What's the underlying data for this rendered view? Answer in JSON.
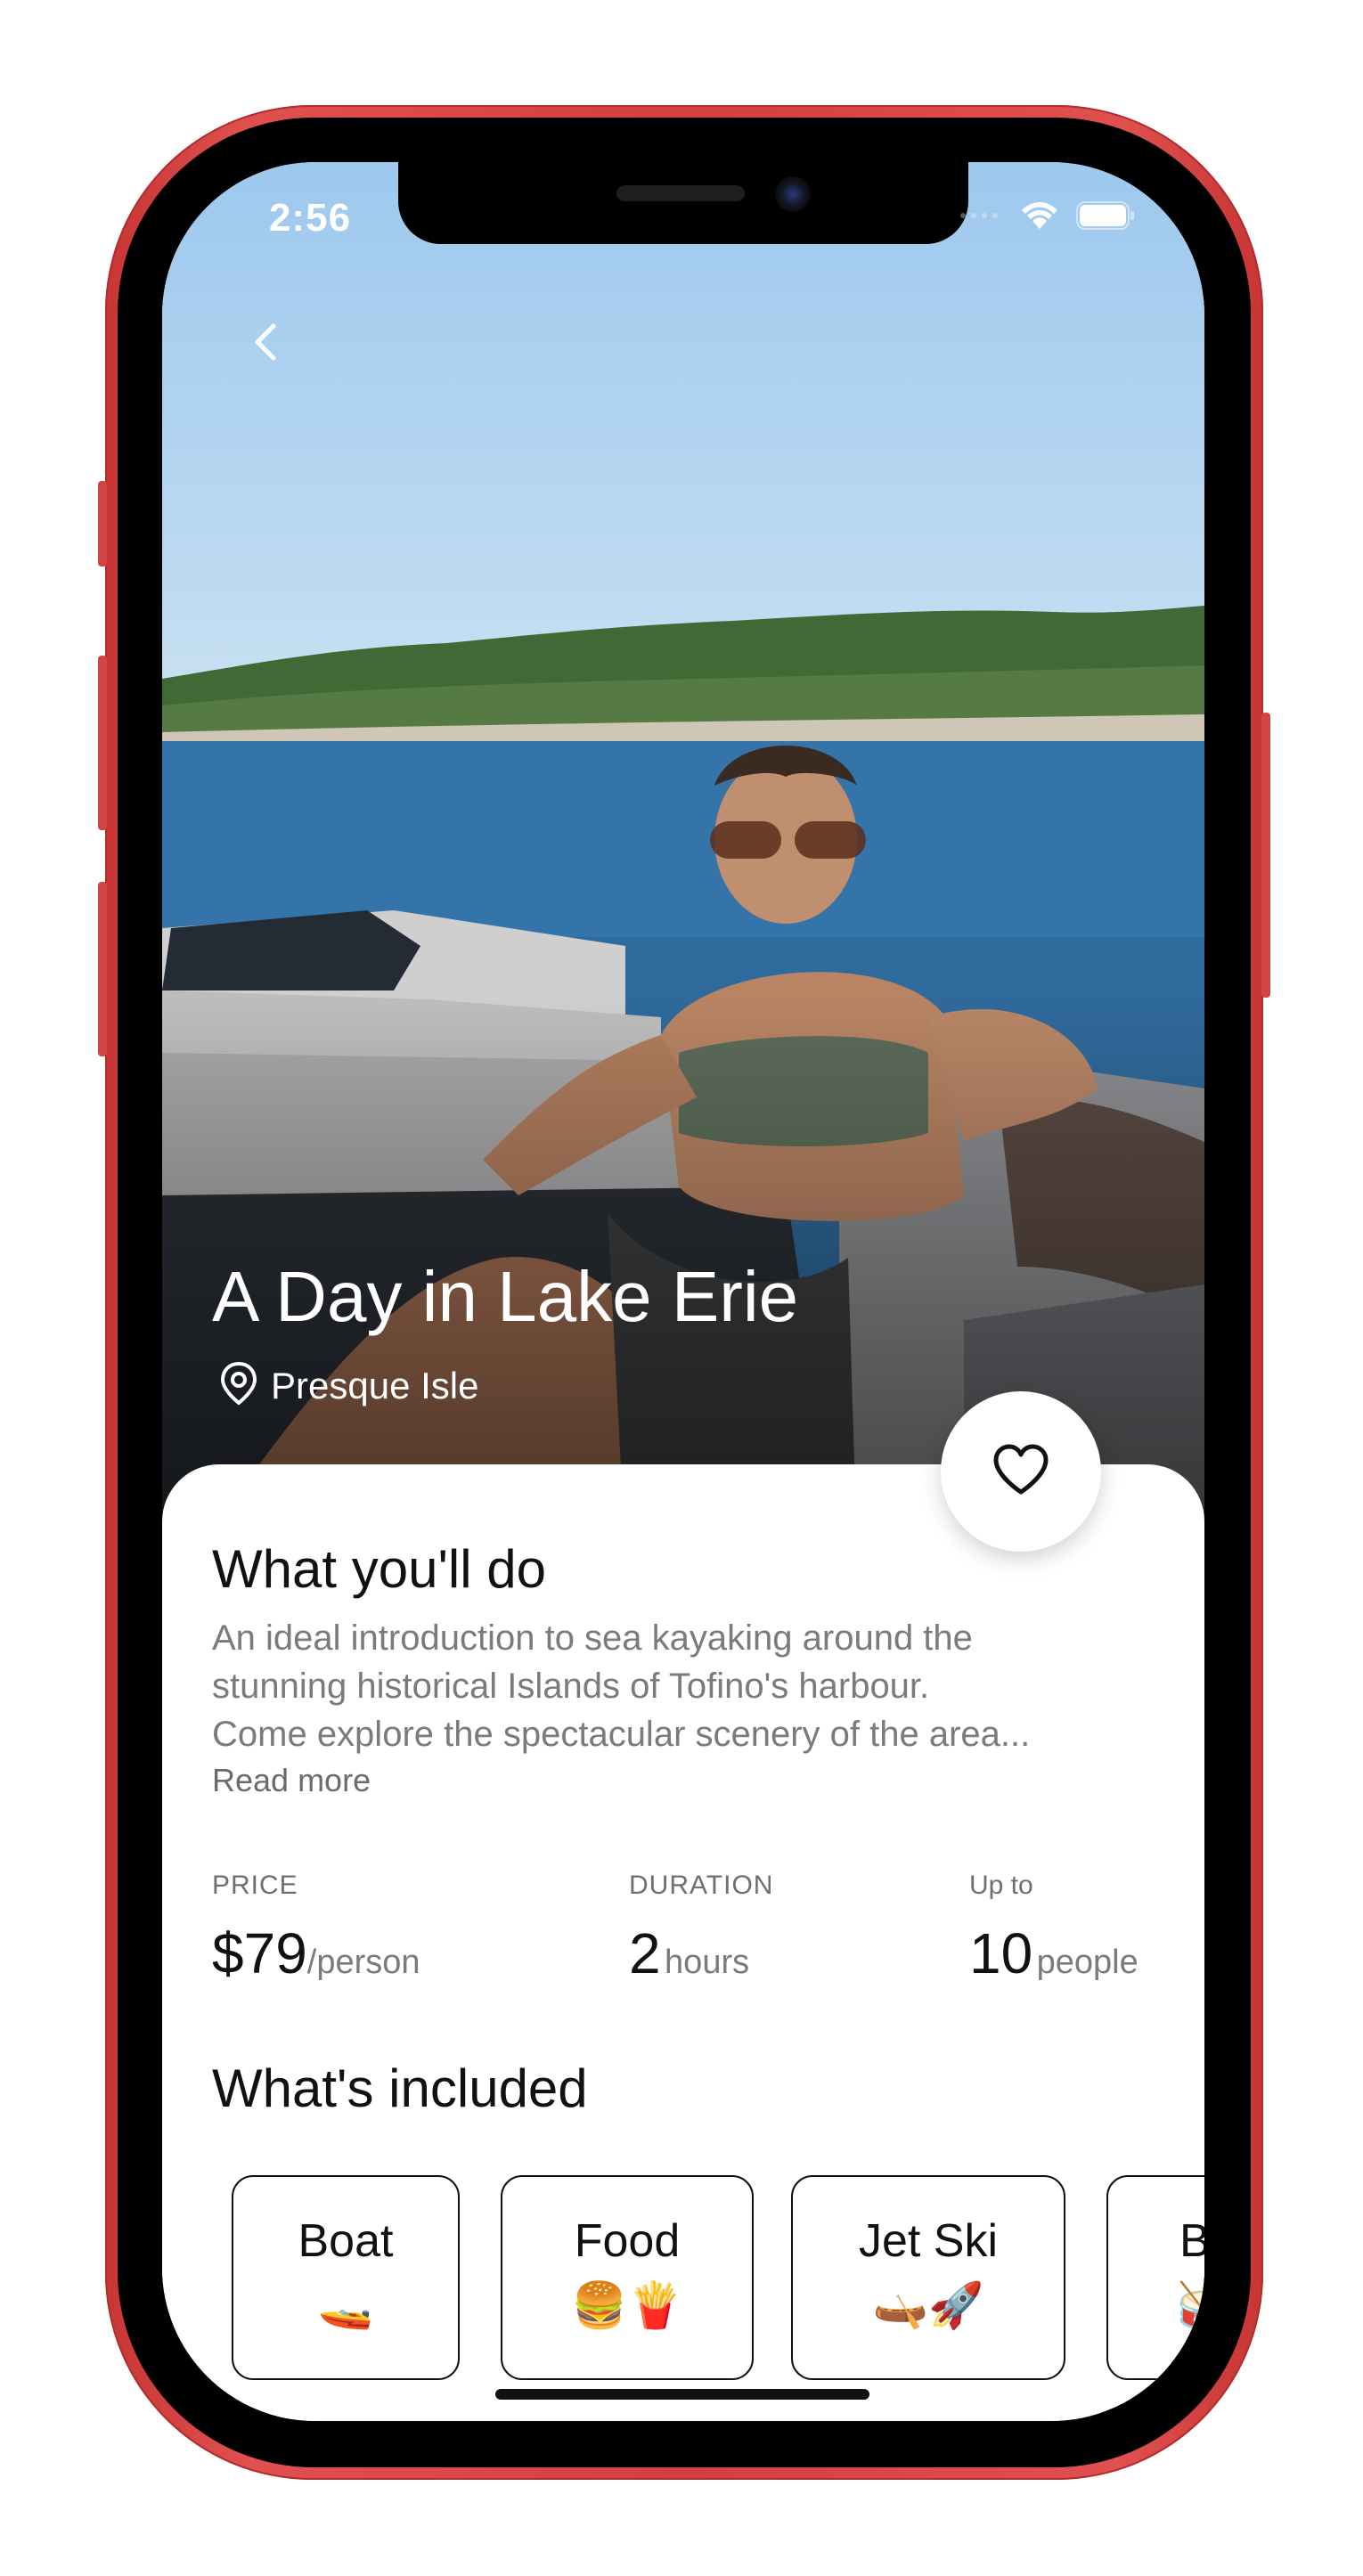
{
  "status_bar": {
    "time": "2:56"
  },
  "hero": {
    "title": "A Day in Lake Erie",
    "location": "Presque Isle"
  },
  "about": {
    "heading": "What you'll do",
    "description_lines": [
      "An ideal introduction to sea kayaking around the",
      "stunning historical Islands of Tofino's harbour.",
      "Come explore the spectacular scenery of the area..."
    ],
    "read_more": "Read more"
  },
  "stats": {
    "price": {
      "label": "PRICE",
      "value": "$79",
      "unit": "/person"
    },
    "duration": {
      "label": "DURATION",
      "value": "2",
      "unit": "hours"
    },
    "capacity": {
      "label": "Up to",
      "value": "10",
      "unit": "people"
    }
  },
  "included": {
    "heading": "What's included",
    "items": [
      {
        "label": "Boat",
        "emoji": "🚤"
      },
      {
        "label": "Food",
        "emoji": "🍔🍟"
      },
      {
        "label": "Jet Ski",
        "emoji": "🛶🚀"
      },
      {
        "label": "B",
        "emoji": "🥁"
      }
    ]
  },
  "colors": {
    "phone_frame": "#d94848",
    "text_primary": "#111111",
    "text_secondary": "#7b7b7b"
  },
  "icons": {
    "back": "chevron-left-icon",
    "location": "map-pin-icon",
    "favorite": "heart-outline-icon",
    "wifi": "wifi-icon",
    "battery": "battery-icon"
  }
}
